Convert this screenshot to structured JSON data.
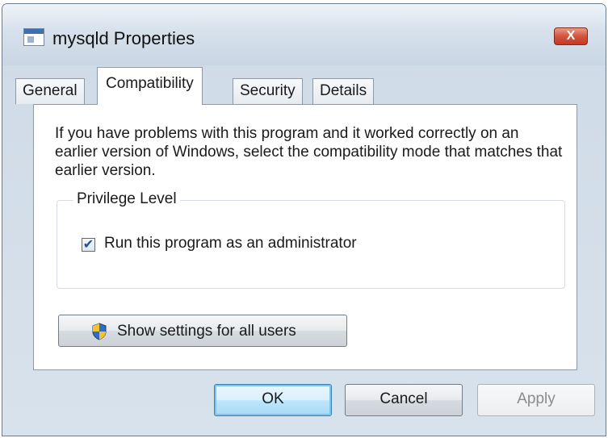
{
  "window": {
    "title": "mysqld Properties",
    "close_label": "X"
  },
  "tabs": [
    {
      "label": "General"
    },
    {
      "label": "Compatibility",
      "active": true
    },
    {
      "label": "Security"
    },
    {
      "label": "Details"
    }
  ],
  "panel": {
    "description": "If you have problems with this program and it worked correctly on an earlier version of Windows, select the compatibility mode that matches that earlier version.",
    "privilege_group_label": "Privilege Level",
    "run_as_admin_label": "Run this program as an administrator",
    "run_as_admin_checked": true,
    "show_settings_label": "Show settings for all users"
  },
  "buttons": {
    "ok": "OK",
    "cancel": "Cancel",
    "apply": "Apply"
  },
  "icons": {
    "title": "program-window-icon",
    "close": "close-icon",
    "shield": "uac-shield-icon",
    "check": "checkmark-icon"
  },
  "colors": {
    "close_button": "#c23a22",
    "default_button_border": "#3c7fb1",
    "shield_blue": "#2f6fc1",
    "shield_yellow": "#f2c232"
  }
}
